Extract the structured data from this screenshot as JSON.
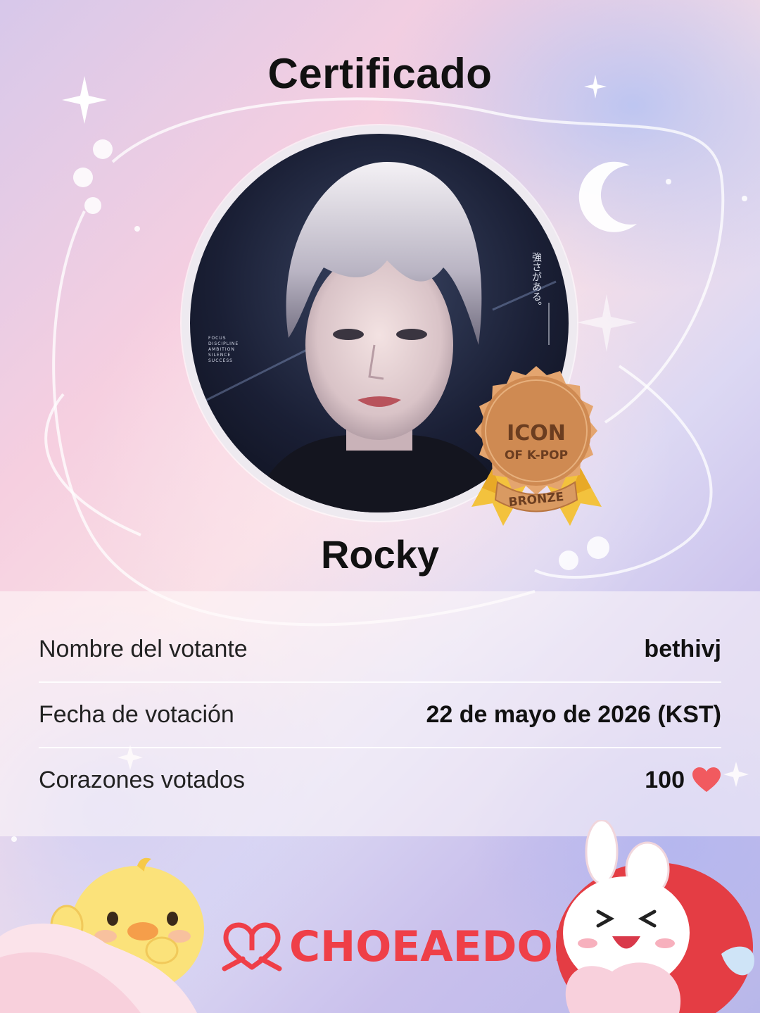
{
  "certificate": {
    "title": "Certificado",
    "idol_name": "Rocky"
  },
  "badge": {
    "line1": "ICON",
    "line2": "OF K-POP",
    "tier": "BRONZE",
    "color": "#cf8a52"
  },
  "details": [
    {
      "label": "Nombre del votante",
      "value": "bethivj"
    },
    {
      "label": "Fecha de votación",
      "value": "22 de mayo de 2026 (KST)"
    },
    {
      "label": "Corazones votados",
      "value": "100",
      "icon": "heart-icon"
    }
  ],
  "brand": {
    "name": "CHOEAEDOL",
    "color": "#ef3f48"
  },
  "photo_text": {
    "vertical_jp": "強さがある。",
    "words": [
      "FOCUS",
      "DISCIPLINE",
      "AMBITION",
      "SILENCE",
      "SUCCESS"
    ]
  }
}
